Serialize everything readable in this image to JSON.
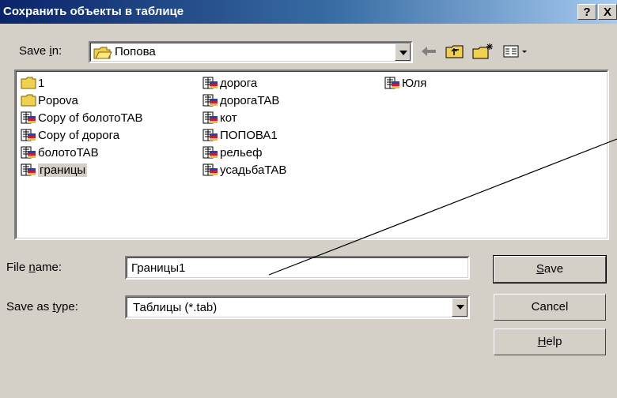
{
  "title": "Сохранить объекты в таблице",
  "title_buttons": {
    "help": "?",
    "close": "X"
  },
  "save_in": {
    "label_pre": "Save ",
    "label_key": "i",
    "label_post": "n:",
    "folder": "Попова"
  },
  "toolbar_icons": [
    "back-arrow-icon",
    "up-folder-icon",
    "new-folder-icon",
    "view-menu-icon"
  ],
  "files": [
    {
      "name": "1",
      "type": "folder"
    },
    {
      "name": "Popova",
      "type": "folder"
    },
    {
      "name": "Copy of болотоTAB",
      "type": "table"
    },
    {
      "name": "Copy of дорога",
      "type": "table"
    },
    {
      "name": "болотоTAB",
      "type": "table"
    },
    {
      "name": "границы",
      "type": "table",
      "selected": true
    },
    {
      "name": "дорога",
      "type": "table"
    },
    {
      "name": "дорогаTAB",
      "type": "table"
    },
    {
      "name": "кот",
      "type": "table"
    },
    {
      "name": "ПОПОВА1",
      "type": "table"
    },
    {
      "name": "рельеф",
      "type": "table"
    },
    {
      "name": "усадьбаTAB",
      "type": "table"
    },
    {
      "name": "Юля",
      "type": "table"
    }
  ],
  "filename": {
    "label_pre": "File ",
    "label_key": "n",
    "label_post": "ame:",
    "value": "Границы1"
  },
  "filetype": {
    "label_pre": "Save as ",
    "label_key": "t",
    "label_post": "ype:",
    "value": "Таблицы (*.tab)"
  },
  "buttons": {
    "save_key": "S",
    "save_rest": "ave",
    "cancel": "Cancel",
    "help_key": "H",
    "help_rest": "elp"
  },
  "colors": {
    "title_start": "#0a246a",
    "title_end": "#a6caf0",
    "face": "#d4d0c8",
    "selection": "#d4d0c8"
  }
}
